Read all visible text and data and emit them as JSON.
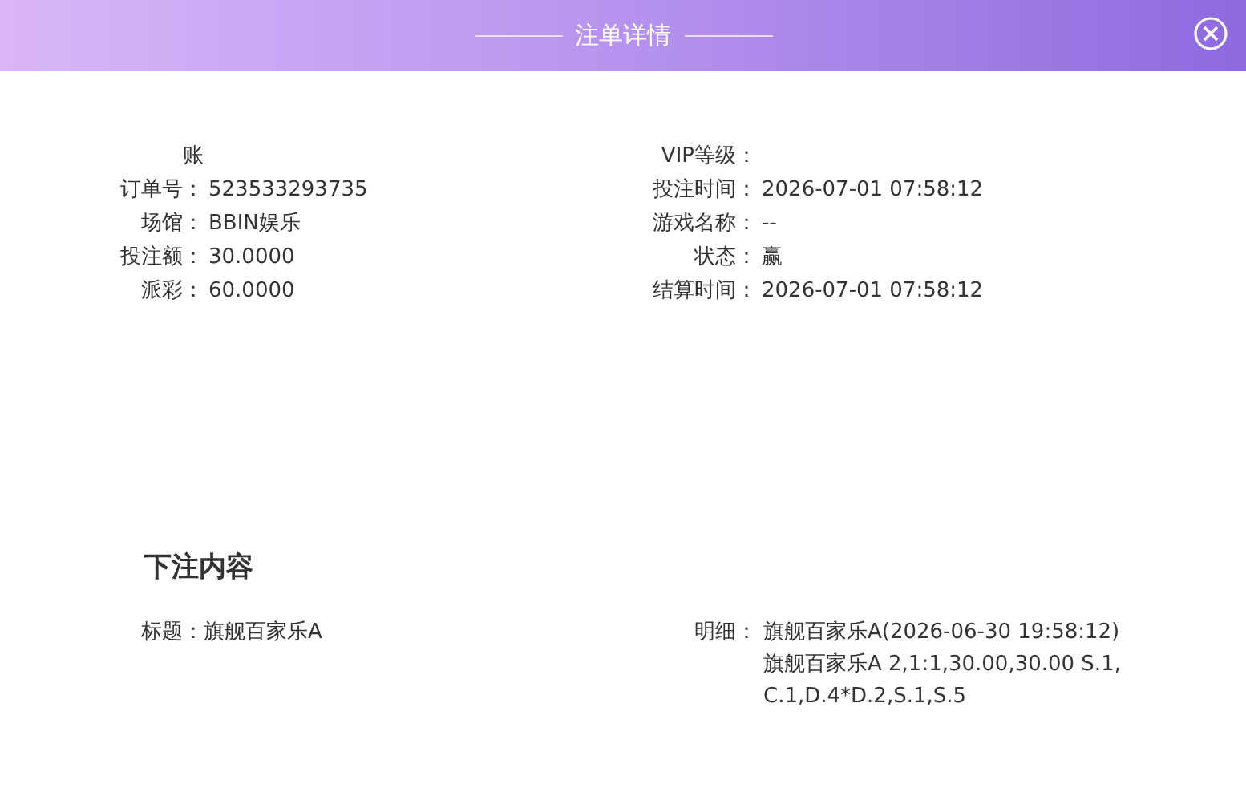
{
  "dialog": {
    "title": "注单详情"
  },
  "info_rows": [
    {
      "left": {
        "label": "账"
      },
      "right": {
        "label": "VIP等级："
      }
    },
    {
      "left": {
        "label": "订单号：",
        "value": "523533293735"
      },
      "right": {
        "label": "投注时间：",
        "value": "2026-07-01 07:58:12"
      }
    },
    {
      "left": {
        "label": "场馆：",
        "value": "BBIN娱乐"
      },
      "right": {
        "label": "游戏名称：",
        "value": "--"
      }
    },
    {
      "left": {
        "label": "投注额：",
        "value": "30.0000"
      },
      "right": {
        "label": "状态：",
        "value": "赢"
      }
    },
    {
      "left": {
        "label": "派彩：",
        "value": "60.0000"
      },
      "right": {
        "label": "结算时间：",
        "value": "2026-07-01 07:58:12"
      }
    }
  ],
  "bet_content": {
    "heading": "下注内容",
    "title": {
      "label": "标题：",
      "value": "旗舰百家乐A"
    },
    "detail": {
      "label": "明细：",
      "lines": [
        "旗舰百家乐A(2026-06-30 19:58:12)",
        "旗舰百家乐A 2,1:1,30.00,30.00 S.1,C.1,D.4*D.2,S.1,S.5"
      ]
    }
  }
}
